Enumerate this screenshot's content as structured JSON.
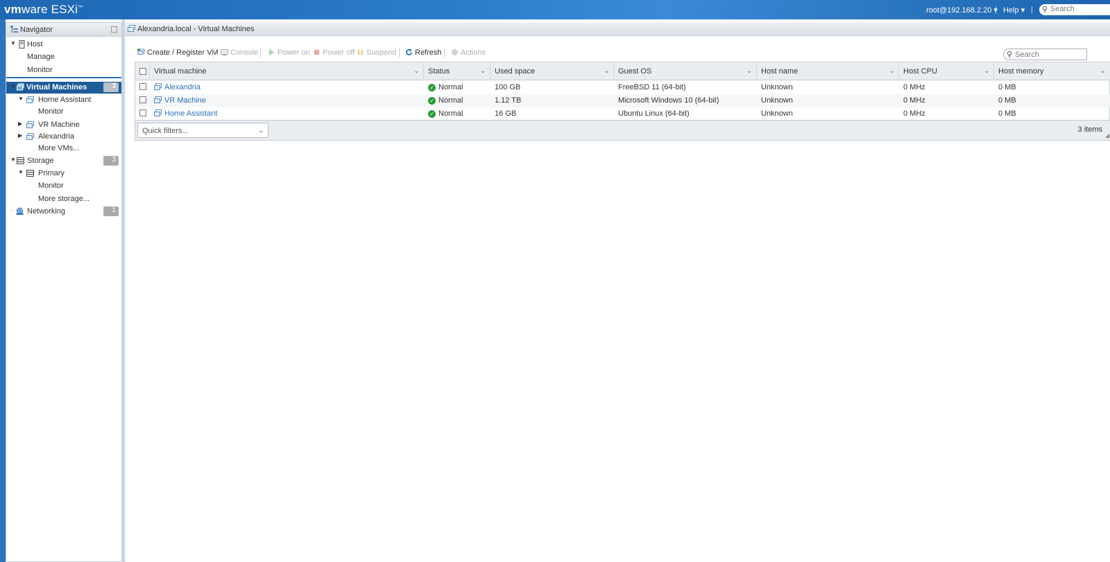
{
  "topbar": {
    "logo_vm": "vm",
    "logo_ware": "ware",
    "logo_product": " ESXi",
    "logo_tm": "™",
    "user": "root@192.168.2.20",
    "help": "Help",
    "search_placeholder": "Search"
  },
  "navigator": {
    "title": "Navigator",
    "items": [
      {
        "label": "Host"
      },
      {
        "label": "Manage"
      },
      {
        "label": "Monitor"
      },
      {
        "label": "Virtual Machines",
        "badge": "3"
      },
      {
        "label": "Home Assistant"
      },
      {
        "label": "Monitor"
      },
      {
        "label": "VR Machine"
      },
      {
        "label": "Alexandria"
      },
      {
        "label": "More VMs..."
      },
      {
        "label": "Storage",
        "badge": "3"
      },
      {
        "label": "Primary"
      },
      {
        "label": "Monitor"
      },
      {
        "label": "More storage..."
      },
      {
        "label": "Networking",
        "badge": "1"
      }
    ]
  },
  "main": {
    "title": "Alexandria.local - Virtual Machines",
    "toolbar": {
      "create": "Create / Register VM",
      "console": "Console",
      "power_on": "Power on",
      "power_off": "Power off",
      "suspend": "Suspend",
      "refresh": "Refresh",
      "actions": "Actions"
    },
    "search_placeholder": "Search",
    "columns": [
      "Virtual machine",
      "Status",
      "Used space",
      "Guest OS",
      "Host name",
      "Host CPU",
      "Host memory"
    ],
    "rows": [
      {
        "name": "Alexandria",
        "status": "Normal",
        "used": "100 GB",
        "os": "FreeBSD 11 (64-bit)",
        "host": "Unknown",
        "cpu": "0 MHz",
        "mem": "0 MB"
      },
      {
        "name": "VR Machine",
        "status": "Normal",
        "used": "1.12 TB",
        "os": "Microsoft Windows 10 (64-bit)",
        "host": "Unknown",
        "cpu": "0 MHz",
        "mem": "0 MB"
      },
      {
        "name": "Home Assistant",
        "status": "Normal",
        "used": "16 GB",
        "os": "Ubuntu Linux (64-bit)",
        "host": "Unknown",
        "cpu": "0 MHz",
        "mem": "0 MB"
      }
    ],
    "quick_filters": "Quick filters...",
    "items_count": "3 items"
  },
  "colors": {
    "topbar": "#2a7ccb",
    "selected": "#1f5c9a",
    "link": "#2b6fb6",
    "ok": "#2c9b3a"
  }
}
